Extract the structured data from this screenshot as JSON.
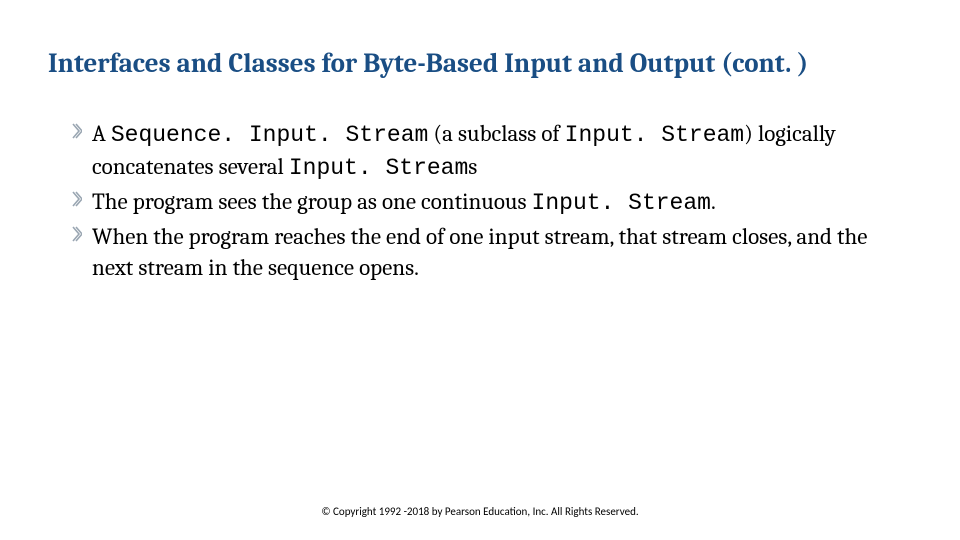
{
  "title": "Interfaces and Classes for Byte-Based Input and Output (cont. )",
  "bullets": [
    {
      "segments": [
        {
          "t": "A ",
          "mono": false
        },
        {
          "t": "Sequence. Input. Stream",
          "mono": true
        },
        {
          "t": " (a subclass of ",
          "mono": false
        },
        {
          "t": "Input. Stream",
          "mono": true
        },
        {
          "t": ") logically concatenates several ",
          "mono": false
        },
        {
          "t": "Input. Stream",
          "mono": true
        },
        {
          "t": "s",
          "mono": false
        }
      ]
    },
    {
      "segments": [
        {
          "t": "The program sees the group as one continuous ",
          "mono": false
        },
        {
          "t": "Input. Stream",
          "mono": true
        },
        {
          "t": ".",
          "mono": false
        }
      ]
    },
    {
      "segments": [
        {
          "t": "When the program reaches the end of one input stream, that stream closes, and the next stream in the sequence opens.",
          "mono": false
        }
      ]
    }
  ],
  "footer": "© Copyright 1992 -2018 by Pearson Education, Inc. All Rights Reserved."
}
